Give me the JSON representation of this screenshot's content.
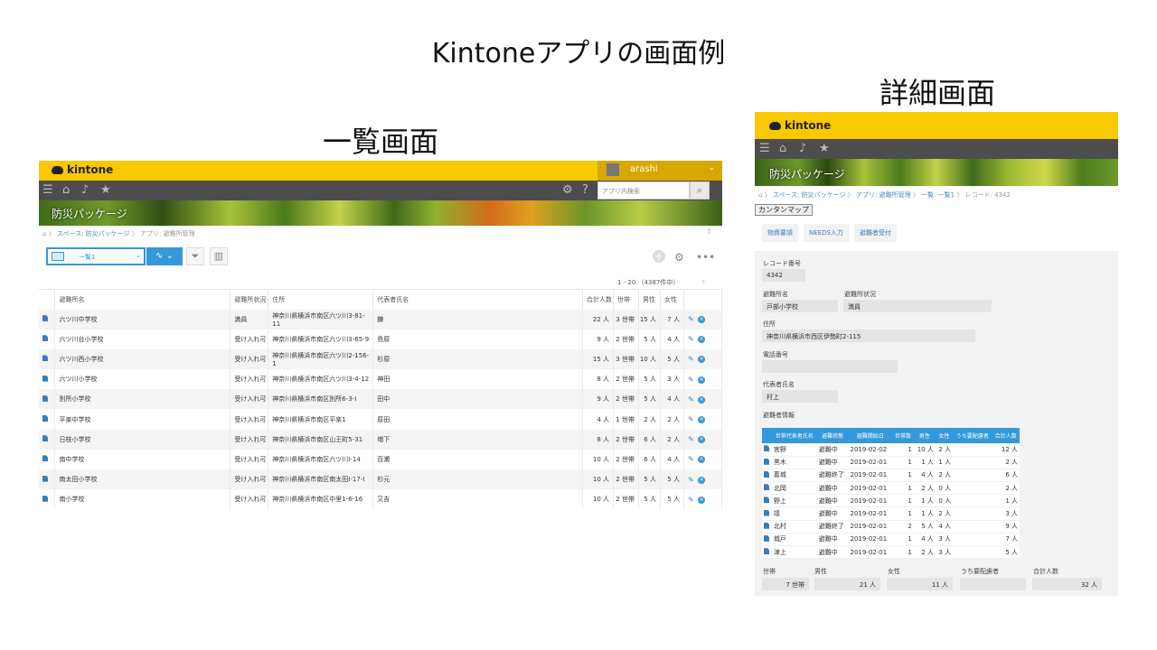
{
  "slide": {
    "title": "Kintoneアプリの画面例",
    "list_heading": "一覧画面",
    "detail_heading": "詳細画面"
  },
  "list": {
    "brand": "kintone",
    "user_name": "arashi",
    "search_placeholder": "アプリ内検索",
    "banner_title": "防災パッケージ",
    "breadcrumb": {
      "space": "スペース: 防災パッケージ",
      "sep": "〉",
      "app": "アプリ: 避難所管理"
    },
    "view_name": "一覧1",
    "pager_text": "1 - 20 （4387件中）",
    "columns": [
      "避難所名",
      "避難所状況",
      "住所",
      "代表者氏名",
      "合計人数",
      "世帯",
      "男性",
      "女性"
    ],
    "rows": [
      {
        "name": "六ツ川中学校",
        "status": "満員",
        "address": "神奈川県横浜市南区六ツ川3-81-11",
        "rep": "錬",
        "total": "22 人",
        "households": "3 世帯",
        "male": "15 人",
        "female": "7 人"
      },
      {
        "name": "六ツ川台小学校",
        "status": "受け入れ可",
        "address": "神奈川県横浜市南区六ツ川3-65-9",
        "rep": "島原",
        "total": "9 人",
        "households": "2 世帯",
        "male": "5 人",
        "female": "4 人"
      },
      {
        "name": "六ツ川西小学校",
        "status": "受け入れ可",
        "address": "神奈川県横浜市南区六ツ川2-156-1",
        "rep": "杉原",
        "total": "15 人",
        "households": "3 世帯",
        "male": "10 人",
        "female": "5 人"
      },
      {
        "name": "六ツ川小学校",
        "status": "受け入れ可",
        "address": "神奈川県横浜市南区六ツ川3-4-12",
        "rep": "神田",
        "total": "8 人",
        "households": "2 世帯",
        "male": "5 人",
        "female": "3 人"
      },
      {
        "name": "別所小学校",
        "status": "受け入れ可",
        "address": "神奈川県横浜市南区別所6-3-I",
        "rep": "田中",
        "total": "9 人",
        "households": "2 世帯",
        "male": "5 人",
        "female": "4 人"
      },
      {
        "name": "平楽中学校",
        "status": "受け入れ可",
        "address": "神奈川県横浜市南区平楽1",
        "rep": "原田",
        "total": "4 人",
        "households": "1 世帯",
        "male": "2 人",
        "female": "2 人"
      },
      {
        "name": "日枝小学校",
        "status": "受け入れ可",
        "address": "神奈川県横浜市南区山王町5-31",
        "rep": "増下",
        "total": "8 人",
        "households": "2 世帯",
        "male": "6 人",
        "female": "2 人"
      },
      {
        "name": "南中学校",
        "status": "受け入れ可",
        "address": "神奈川県横浜市南区六ツ川I-14",
        "rep": "百瀬",
        "total": "10 人",
        "households": "2 世帯",
        "male": "6 人",
        "female": "4 人"
      },
      {
        "name": "南太田小学校",
        "status": "受け入れ可",
        "address": "神奈川県横浜市南区南太田I-17-I",
        "rep": "杉元",
        "total": "10 人",
        "households": "2 世帯",
        "male": "5 人",
        "female": "5 人"
      },
      {
        "name": "南小学校",
        "status": "受け入れ可",
        "address": "神奈川県横浜市南区中里1-6-16",
        "rep": "又吉",
        "total": "10 人",
        "households": "2 世帯",
        "male": "5 人",
        "female": "5 人"
      }
    ]
  },
  "detail": {
    "brand": "kintone",
    "banner_title": "防災パッケージ",
    "breadcrumb": {
      "space": "スペース: 防災パッケージ",
      "app": "アプリ: 避難所管理",
      "view": "一覧: 一覧1",
      "record": "レコード: 4342",
      "sep": "〉"
    },
    "map_button": "カンタンマップ",
    "tabs": [
      "物資要請",
      "NEEDS入力",
      "避難者受付"
    ],
    "fields": {
      "record_no_label": "レコード番号",
      "record_no": "4342",
      "shelter_label": "避難所名",
      "shelter": "戸部小学校",
      "status_label": "避難所状況",
      "status": "満員",
      "address_label": "住所",
      "address": "神奈川県横浜市西区伊勢町2-115",
      "phone_label": "電話番号",
      "phone": "",
      "rep_label": "代表者氏名",
      "rep": "村上",
      "evac_label": "避難者情報"
    },
    "sub_columns": [
      "世帯代表者氏名",
      "避難状態",
      "避難開始日",
      "世帯数",
      "男性",
      "女性",
      "うち要配慮者",
      "合計人数"
    ],
    "sub_rows": [
      {
        "name": "宮野",
        "state": "避難中",
        "date": "2019-02-02",
        "hh": "1",
        "male": "10 人",
        "female": "2 人",
        "care": "",
        "total": "12 人"
      },
      {
        "name": "黒木",
        "state": "避難中",
        "date": "2019-02-01",
        "hh": "1",
        "male": "1 人",
        "female": "1 人",
        "care": "",
        "total": "2 人"
      },
      {
        "name": "葛城",
        "state": "避難終了",
        "date": "2019-02-01",
        "hh": "1",
        "male": "4 人",
        "female": "2 人",
        "care": "",
        "total": "6 人"
      },
      {
        "name": "北岡",
        "state": "避難中",
        "date": "2019-02-01",
        "hh": "1",
        "male": "2 人",
        "female": "0 人",
        "care": "",
        "total": "2 人"
      },
      {
        "name": "野上",
        "state": "避難中",
        "date": "2019-02-01",
        "hh": "1",
        "male": "1 人",
        "female": "0 人",
        "care": "",
        "total": "1 人"
      },
      {
        "name": "靖",
        "state": "避難中",
        "date": "2019-02-01",
        "hh": "1",
        "male": "1 人",
        "female": "2 人",
        "care": "",
        "total": "3 人"
      },
      {
        "name": "北村",
        "state": "避難終了",
        "date": "2019-02-01",
        "hh": "2",
        "male": "5 人",
        "female": "4 人",
        "care": "",
        "total": "9 人"
      },
      {
        "name": "城戸",
        "state": "避難中",
        "date": "2019-02-01",
        "hh": "1",
        "male": "4 人",
        "female": "3 人",
        "care": "",
        "total": "7 人"
      },
      {
        "name": "津上",
        "state": "避難中",
        "date": "2019-02-01",
        "hh": "1",
        "male": "2 人",
        "female": "3 人",
        "care": "",
        "total": "5 人"
      }
    ],
    "totals": {
      "hh_label": "世帯",
      "hh": "7 世帯",
      "male_label": "男性",
      "male": "21 人",
      "female_label": "女性",
      "female": "11 人",
      "care_label": "うち要配慮者",
      "care": "",
      "total_label": "合計人数",
      "total": "32 人"
    }
  }
}
